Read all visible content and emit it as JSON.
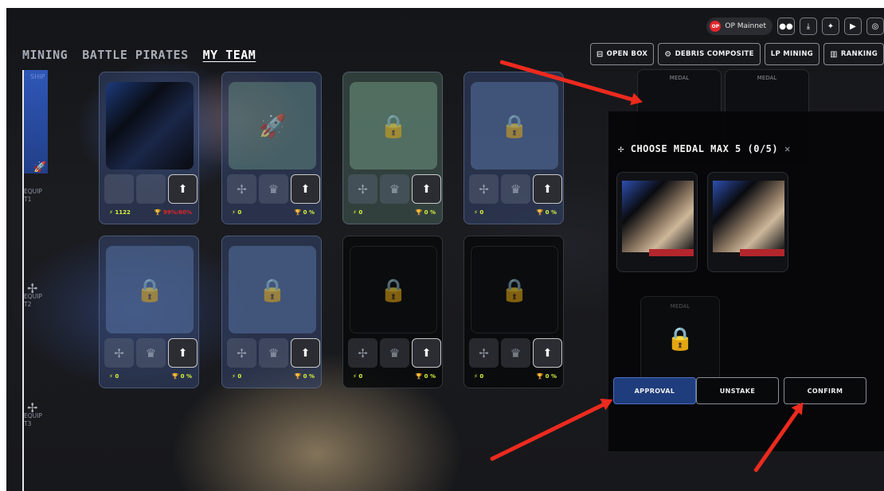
{
  "network": {
    "badge": "OP",
    "label": "OP Mainnet"
  },
  "social_icons": [
    "medium-icon",
    "download-icon",
    "twitter-icon",
    "youtube-icon",
    "discord-icon"
  ],
  "actions": [
    {
      "label": "OPEN BOX",
      "icon": "box-icon"
    },
    {
      "label": "DEBRIS COMPOSITE",
      "icon": "composite-icon"
    },
    {
      "label": "LP MINING",
      "icon": ""
    },
    {
      "label": "RANKING",
      "icon": "ranking-icon"
    }
  ],
  "nav": {
    "mining": "MINING",
    "battle": "BATTLE PIRATES",
    "team": "MY TEAM"
  },
  "rail": {
    "ship": "SHIP",
    "equip1": "EQUIP",
    "t1": "T1",
    "equip2": "EQUIP",
    "t2": "T2",
    "equip3": "EQUIP",
    "t3": "T3"
  },
  "cards": [
    {
      "power": "1122",
      "trophy": "99%/60%"
    },
    {
      "power": "0",
      "trophy": "0 %"
    },
    {
      "power": "0",
      "trophy": "0 %"
    },
    {
      "power": "0",
      "trophy": "0 %"
    },
    {
      "power": "0",
      "trophy": "0 %"
    },
    {
      "power": "0",
      "trophy": "0 %"
    },
    {
      "power": "0",
      "trophy": "0 %"
    },
    {
      "power": "0",
      "trophy": "0 %"
    }
  ],
  "medal_label": "MEDAL",
  "modal": {
    "title": "CHOOSE MEDAL MAX 5 (0/5)",
    "approval": "APPROVAL",
    "unstake": "UNSTAKE",
    "confirm": "CONFIRM"
  }
}
